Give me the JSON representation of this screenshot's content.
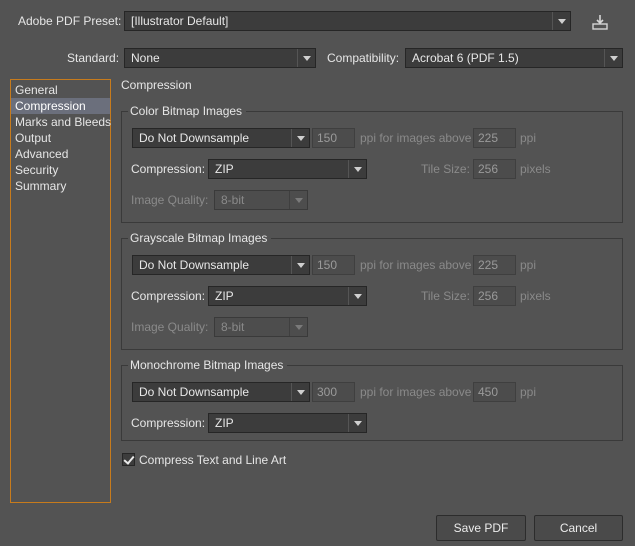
{
  "header": {
    "preset_label": "Adobe PDF Preset:",
    "preset_value": "[Illustrator Default]",
    "standard_label": "Standard:",
    "standard_value": "None",
    "compat_label": "Compatibility:",
    "compat_value": "Acrobat 6 (PDF 1.5)",
    "save_preset_icon": "save-preset-icon"
  },
  "sidebar": {
    "items": [
      {
        "label": "General"
      },
      {
        "label": "Compression",
        "selected": true
      },
      {
        "label": "Marks and Bleeds"
      },
      {
        "label": "Output"
      },
      {
        "label": "Advanced"
      },
      {
        "label": "Security"
      },
      {
        "label": "Summary"
      }
    ]
  },
  "main": {
    "section_title": "Compression",
    "color": {
      "title": "Color Bitmap Images",
      "downsample": "Do Not Downsample",
      "ppi": "150",
      "ppi_label": "ppi for images above",
      "above": "225",
      "above_unit": "ppi",
      "compression_label": "Compression:",
      "compression": "ZIP",
      "tile_label": "Tile Size:",
      "tile": "256",
      "tile_unit": "pixels",
      "quality_label": "Image Quality:",
      "quality": "8-bit"
    },
    "gray": {
      "title": "Grayscale Bitmap Images",
      "downsample": "Do Not Downsample",
      "ppi": "150",
      "ppi_label": "ppi for images above",
      "above": "225",
      "above_unit": "ppi",
      "compression_label": "Compression:",
      "compression": "ZIP",
      "tile_label": "Tile Size:",
      "tile": "256",
      "tile_unit": "pixels",
      "quality_label": "Image Quality:",
      "quality": "8-bit"
    },
    "mono": {
      "title": "Monochrome Bitmap Images",
      "downsample": "Do Not Downsample",
      "ppi": "300",
      "ppi_label": "ppi for images above",
      "above": "450",
      "above_unit": "ppi",
      "compression_label": "Compression:",
      "compression": "ZIP"
    },
    "compress_text_label": "Compress Text and Line Art",
    "compress_text_checked": true
  },
  "footer": {
    "save_label": "Save PDF",
    "cancel_label": "Cancel"
  },
  "colors": {
    "background": "#535353",
    "selection": "#6b6f7c",
    "sidebar_border": "#c77b1c"
  }
}
